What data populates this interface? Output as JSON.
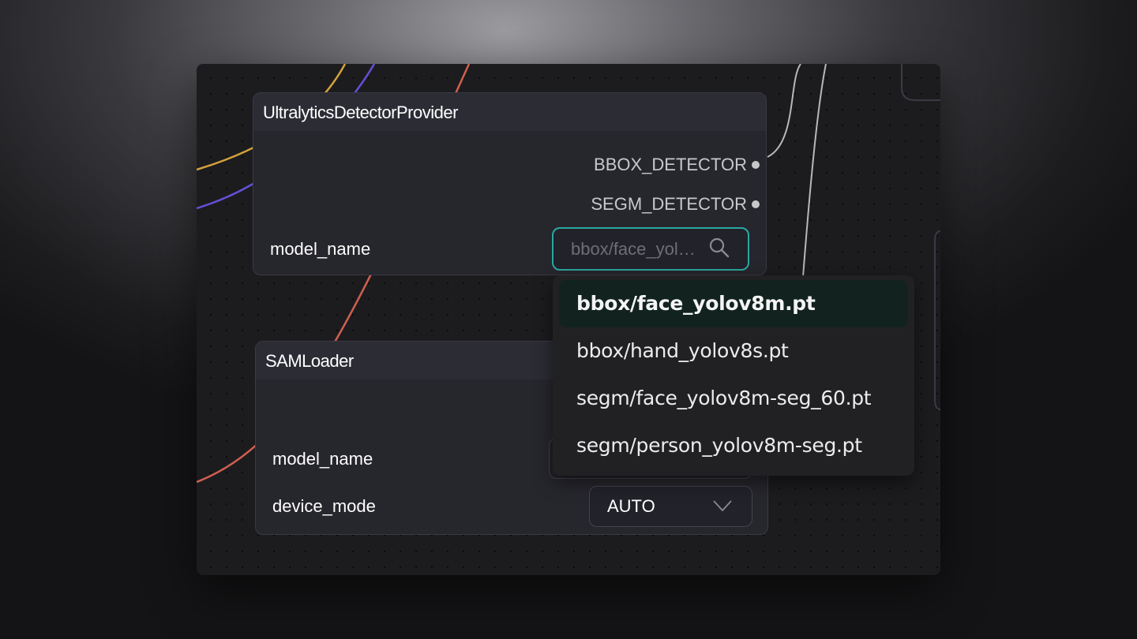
{
  "nodes": {
    "detector": {
      "title": "UltralyticsDetectorProvider",
      "outputs": [
        "BBOX_DETECTOR",
        "SEGM_DETECTOR"
      ],
      "model_name_label": "model_name",
      "model_name_value": "bbox/face_yolov8m.pt",
      "search_icon": "search-icon"
    },
    "sam": {
      "title": "SAMLoader",
      "model_name_label": "model_name",
      "device_mode_label": "device_mode",
      "device_mode_value": "AUTO",
      "chevron_icon": "chevron-down-icon"
    }
  },
  "dropdown": {
    "selected_index": 0,
    "options": [
      "bbox/face_yolov8m.pt",
      "bbox/hand_yolov8s.pt",
      "segm/face_yolov8m-seg_60.pt",
      "segm/person_yolov8m-seg.pt"
    ]
  },
  "colors": {
    "accent_teal": "#2aa9a0",
    "link_orange": "#d4a23a",
    "link_purple": "#6450d8",
    "link_red": "#d06050",
    "link_gray": "#b8b8bc"
  }
}
